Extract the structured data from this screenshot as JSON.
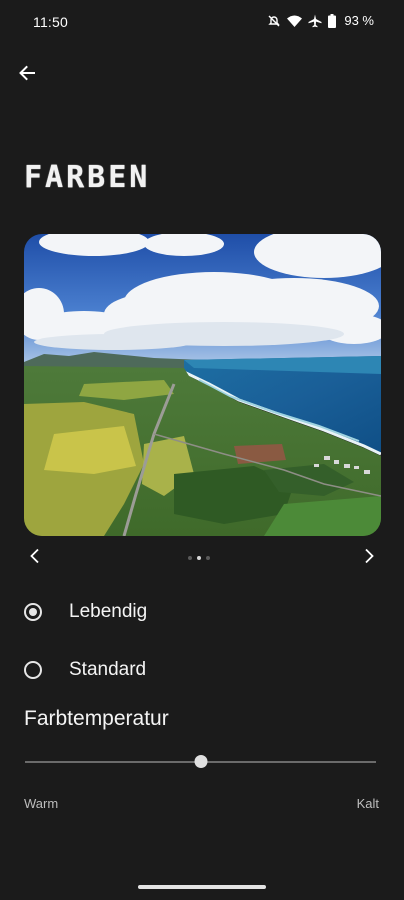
{
  "status_bar": {
    "time": "11:50",
    "battery_percent": "93 %",
    "icons": [
      "do-not-disturb-icon",
      "wifi-icon",
      "airplane-icon",
      "battery-icon"
    ]
  },
  "navigation": {
    "back_icon": "arrow-back-icon"
  },
  "page": {
    "title": "FARBEN"
  },
  "preview": {
    "carousel_page": 2,
    "carousel_total": 3
  },
  "options": [
    {
      "label": "Lebendig",
      "selected": true
    },
    {
      "label": "Standard",
      "selected": false
    }
  ],
  "temperature": {
    "heading": "Farbtemperatur",
    "min_label": "Warm",
    "max_label": "Kalt",
    "value": 0.5
  },
  "colors": {
    "background": "#1b1b1b",
    "text": "#ffffff",
    "accent": "#e0e0e0"
  }
}
